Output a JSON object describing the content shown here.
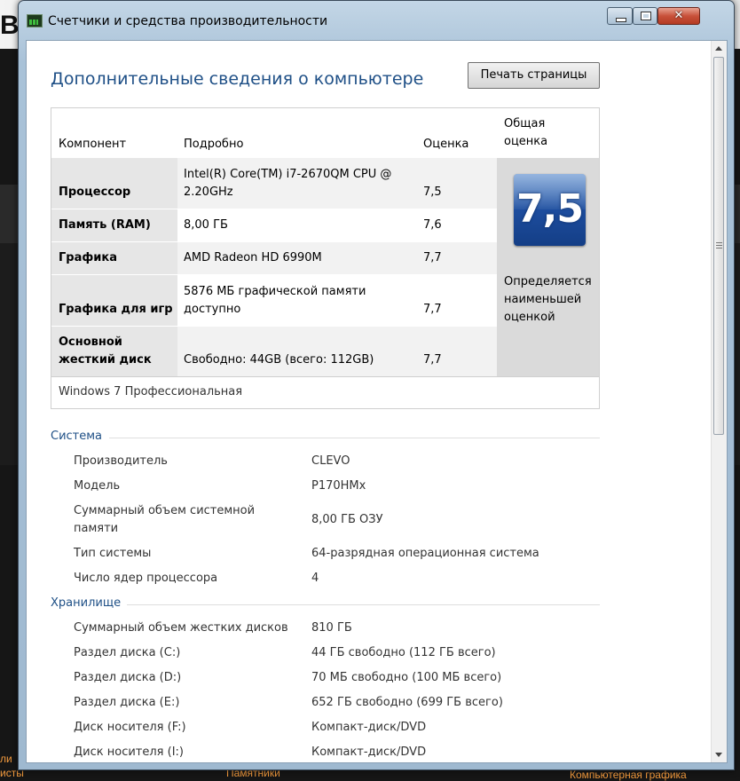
{
  "window": {
    "title": "Счетчики и средства производительности",
    "close_glyph": "✕"
  },
  "page": {
    "heading": "Дополнительные сведения о компьютере",
    "print_button": "Печать страницы"
  },
  "scores": {
    "headers": {
      "component": "Компонент",
      "details": "Подробно",
      "score": "Оценка",
      "overall": "Общая оценка"
    },
    "rows": [
      {
        "component": "Процессор",
        "details": "Intel(R) Core(TM) i7-2670QM CPU @ 2.20GHz",
        "score": "7,5"
      },
      {
        "component": "Память (RAM)",
        "details": "8,00 ГБ",
        "score": "7,6"
      },
      {
        "component": "Графика",
        "details": "AMD Radeon HD 6990M",
        "score": "7,7"
      },
      {
        "component": "Графика для игр",
        "details": "5876 МБ графической памяти доступно",
        "score": "7,7"
      },
      {
        "component": "Основной жесткий диск",
        "details": "Свободно: 44GB (всего: 112GB)",
        "score": "7,7"
      }
    ],
    "overall_score": "7,5",
    "overall_note": "Определяется наименьшей оценкой",
    "os": "Windows 7 Профессиональная"
  },
  "system": {
    "title": "Система",
    "items": [
      {
        "label": "Производитель",
        "value": "CLEVO"
      },
      {
        "label": "Модель",
        "value": "P170HMx"
      },
      {
        "label": "Суммарный объем системной памяти",
        "value": "8,00 ГБ ОЗУ"
      },
      {
        "label": "Тип системы",
        "value": "64-разрядная операционная система"
      },
      {
        "label": "Число ядер процессора",
        "value": "4"
      }
    ]
  },
  "storage": {
    "title": "Хранилище",
    "items": [
      {
        "label": "Суммарный объем жестких дисков",
        "value": "810 ГБ"
      },
      {
        "label": "Раздел диска (C:)",
        "value": "44 ГБ свободно (112 ГБ всего)"
      },
      {
        "label": "Раздел диска (D:)",
        "value": "70 МБ свободно (100 МБ всего)"
      },
      {
        "label": "Раздел диска (E:)",
        "value": "652 ГБ свободно (699 ГБ всего)"
      },
      {
        "label": "Диск носителя (F:)",
        "value": "Компакт-диск/DVD"
      },
      {
        "label": "Диск носителя (I:)",
        "value": "Компакт-диск/DVD"
      }
    ]
  },
  "background": {
    "logo": "B",
    "bottom_links": [
      "ли",
      "исты",
      "Памятники",
      "Компьютерная графика"
    ]
  }
}
